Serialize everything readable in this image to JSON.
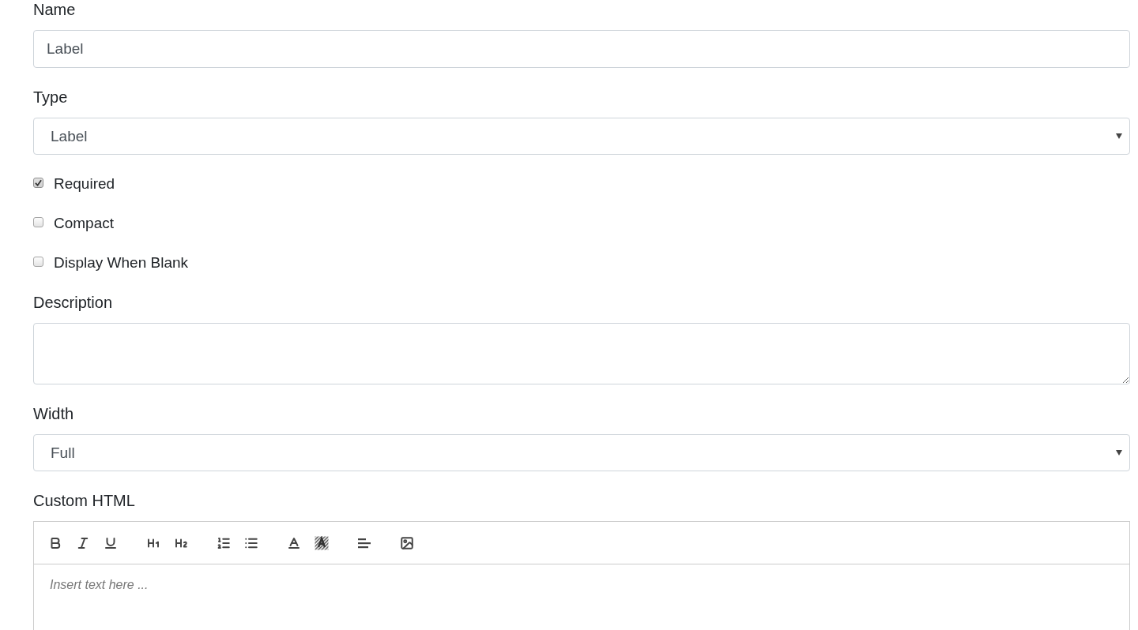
{
  "fields": [
    {
      "kind": "text",
      "label": "Name",
      "value": "Label"
    },
    {
      "kind": "select",
      "label": "Type",
      "value": "Label"
    },
    {
      "kind": "checkbox",
      "label": "Required",
      "checked": true
    },
    {
      "kind": "checkbox",
      "label": "Compact",
      "checked": false
    },
    {
      "kind": "checkbox",
      "label": "Display When Blank",
      "checked": false
    },
    {
      "kind": "textarea",
      "label": "Description"
    },
    {
      "kind": "select",
      "label": "Width",
      "value": "Full"
    },
    {
      "kind": "editor",
      "label": "Custom HTML",
      "placeholder": "Insert text here ..."
    }
  ]
}
